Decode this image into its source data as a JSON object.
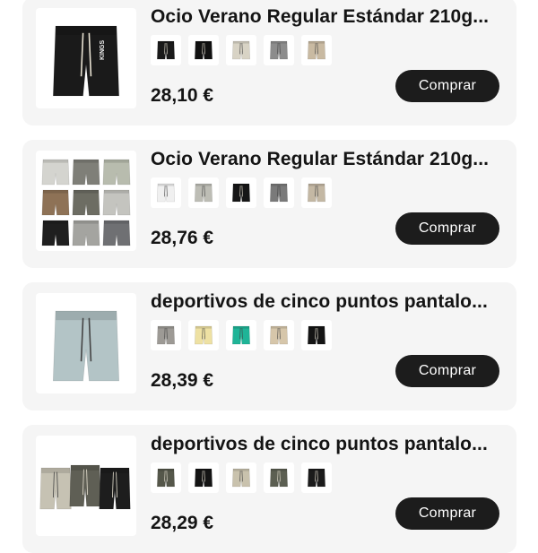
{
  "products": [
    {
      "title": "Ocio Verano Regular Estándar 210g...",
      "price": "28,10 €",
      "buy_label": "Comprar",
      "main_image": {
        "kind": "single-shorts",
        "color": "#1a1a1a",
        "print_text": "KINGS"
      },
      "color_swatches": [
        {
          "name": "black-print",
          "color": "#1a1a1a"
        },
        {
          "name": "black-plain",
          "color": "#111111"
        },
        {
          "name": "cream",
          "color": "#d8d3c5"
        },
        {
          "name": "grey",
          "color": "#8c8c8c"
        },
        {
          "name": "beige",
          "color": "#c9baa2"
        }
      ]
    },
    {
      "title": "Ocio Verano Regular Estándar 210g...",
      "price": "28,76 €",
      "buy_label": "Comprar",
      "main_image": {
        "kind": "grid-shorts",
        "colors": [
          "#d4d4cf",
          "#7f7f78",
          "#b8bcae",
          "#8e7256",
          "#6d6d63",
          "#c4c4bf",
          "#1f1f1f",
          "#a4a4a0",
          "#6f7073"
        ]
      },
      "color_swatches": [
        {
          "name": "white",
          "color": "#f0f0f0"
        },
        {
          "name": "light-grey",
          "color": "#bdbdb5"
        },
        {
          "name": "black",
          "color": "#161616"
        },
        {
          "name": "dark-grey",
          "color": "#7a7a7a"
        },
        {
          "name": "sand",
          "color": "#c4b8a4"
        }
      ]
    },
    {
      "title": "deportivos de cinco puntos pantalo...",
      "price": "28,39 €",
      "buy_label": "Comprar",
      "main_image": {
        "kind": "single-shorts",
        "color": "#b3c4c6",
        "print_text": ""
      },
      "color_swatches": [
        {
          "name": "grey",
          "color": "#9d9a95"
        },
        {
          "name": "pale-yellow",
          "color": "#eee1a3"
        },
        {
          "name": "teal",
          "color": "#1fb497"
        },
        {
          "name": "oat",
          "color": "#d6c6aa"
        },
        {
          "name": "black",
          "color": "#141414"
        }
      ]
    },
    {
      "title": "deportivos de cinco puntos pantalo...",
      "price": "28,29 €",
      "buy_label": "Comprar",
      "main_image": {
        "kind": "trio-shorts",
        "colors": [
          "#c6c2b3",
          "#5f5f55",
          "#1d1d1d"
        ]
      },
      "color_swatches": [
        {
          "name": "olive",
          "color": "#55574a"
        },
        {
          "name": "black",
          "color": "#141414"
        },
        {
          "name": "stone",
          "color": "#c9c2ad"
        },
        {
          "name": "army",
          "color": "#5c5f52"
        },
        {
          "name": "black-2",
          "color": "#1b1b1b"
        }
      ]
    }
  ]
}
